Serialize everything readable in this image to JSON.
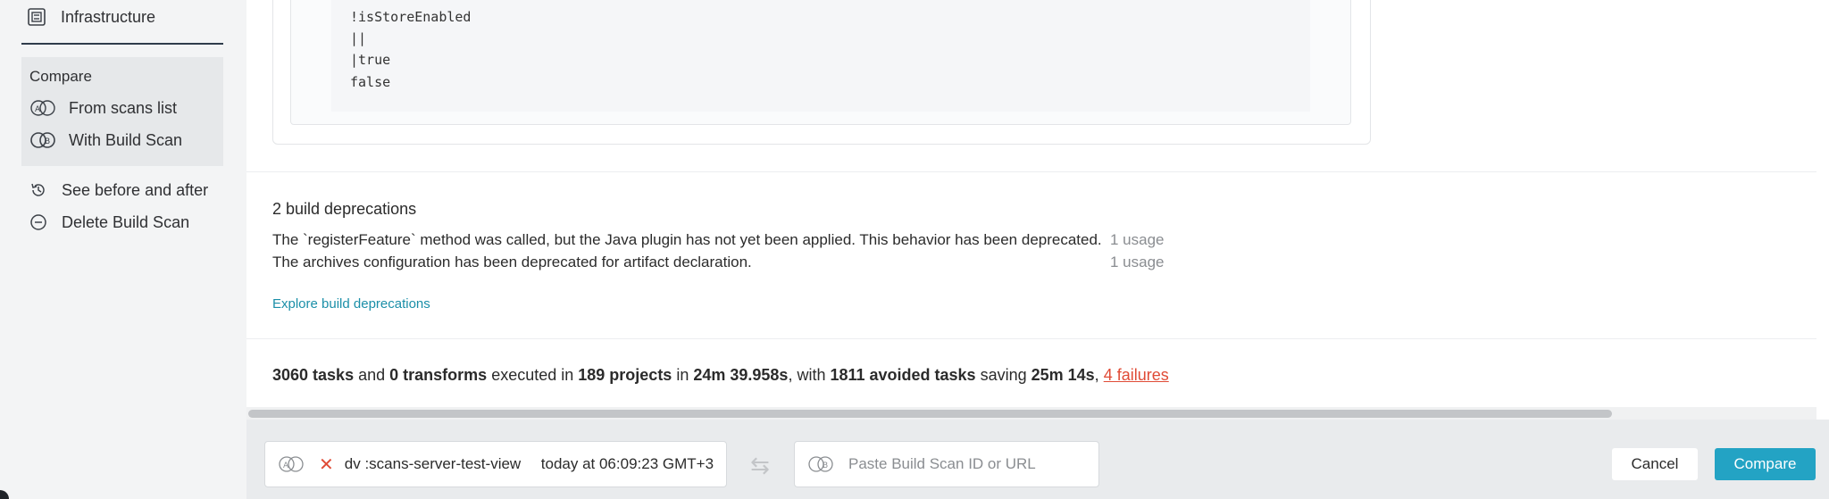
{
  "sidebar": {
    "infrastructure_label": "Infrastructure",
    "compare_title": "Compare",
    "from_scans_list": "From scans list",
    "with_build_scan": "With Build Scan",
    "see_before_after": "See before and after",
    "delete_build_scan": "Delete Build Scan"
  },
  "code": {
    "lines": [
      "!isStoreEnabled",
      "||",
      "|true",
      "false"
    ]
  },
  "deprecations": {
    "title": "2 build deprecations",
    "items": [
      {
        "message": "The `registerFeature` method was called, but the Java plugin has not yet been applied. This behavior has been deprecated.",
        "usage": "1 usage"
      },
      {
        "message": "The archives configuration has been deprecated for artifact declaration.",
        "usage": "1 usage"
      }
    ],
    "explore_link": "Explore build deprecations"
  },
  "summary": {
    "tasks": "3060 tasks",
    "and": " and ",
    "transforms": "0 transforms",
    "executed_in": " executed in ",
    "projects": "189 projects",
    "in": " in ",
    "duration": "24m 39.958s",
    "with": ", with ",
    "avoided": "1811 avoided tasks",
    "saving": " saving ",
    "saved": "25m 14s",
    "comma": ", ",
    "failures": "4 failures"
  },
  "compare_bar": {
    "scan_name": "dv :scans-server-test-view",
    "scan_time": "today at 06:09:23 GMT+3",
    "placeholder": "Paste Build Scan ID or URL",
    "cancel_label": "Cancel",
    "compare_label": "Compare"
  },
  "colors": {
    "accent": "#23a3c4",
    "link": "#1b8fa8",
    "failure": "#e04b36",
    "sidebar_bg": "#f3f4f5"
  }
}
